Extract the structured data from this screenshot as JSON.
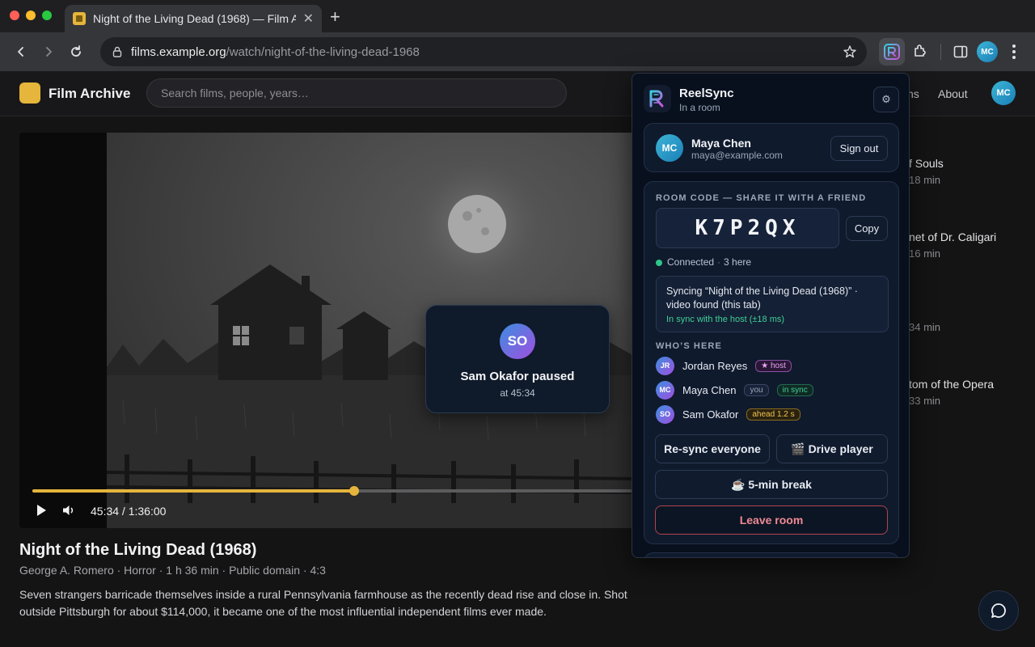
{
  "browser": {
    "tab_title": "Night of the Living Dead (1968) — Film A…",
    "url_host": "films.example.org",
    "url_path": "/watch/night-of-the-living-dead-1968",
    "profile_initials": "MC"
  },
  "site": {
    "logo_text": "Film Archive",
    "search_placeholder": "Search films, people, years…",
    "nav": [
      "ns",
      "About"
    ],
    "avatar_initials": "MC"
  },
  "player": {
    "time_current": "45:34",
    "time_total": "1:36:00",
    "progress_fraction": 0.535,
    "toast": {
      "initials": "SO",
      "title": "Sam Okafor paused",
      "subtitle": "at 45:34"
    }
  },
  "film": {
    "title": "Night of the Living Dead (1968)",
    "meta": "George A. Romero · Horror · 1 h 36 min · Public domain · 4:3",
    "description": "Seven strangers barricade themselves inside a rural Pennsylvania farmhouse as the recently dead rise and close in. Shot outside Pittsburgh for about $114,000, it became one of the most influential independent films ever made."
  },
  "sidebar_list": [
    {
      "title": "f Souls",
      "sub": "18 min"
    },
    {
      "title": "net of Dr. Caligari",
      "sub": "16 min"
    },
    {
      "title": "",
      "sub": "34 min"
    },
    {
      "title": "tom of the Opera",
      "sub": "33 min"
    }
  ],
  "extension": {
    "name": "ReelSync",
    "status": "In a room",
    "gear_icon": "⚙",
    "user": {
      "initials": "MC",
      "name": "Maya Chen",
      "email": "maya@example.com",
      "sign_out": "Sign out"
    },
    "room_label": "ROOM CODE — SHARE IT WITH A FRIEND",
    "room_code": "K7P2QX",
    "copy_label": "Copy",
    "connection": "Connected",
    "count": "3 here",
    "sync_line": "Syncing “Night of the Living Dead (1968)” · video found (this tab)",
    "sync_ok": "In sync with the host (±18 ms)",
    "members_label": "WHO’S HERE",
    "members": [
      {
        "initials": "JR",
        "name": "Jordan Reyes",
        "badges": [
          "★ host"
        ]
      },
      {
        "initials": "MC",
        "name": "Maya Chen",
        "badges": [
          "you",
          "in sync"
        ]
      },
      {
        "initials": "SO",
        "name": "Sam Okafor",
        "badges": [
          "ahead 1.2 s"
        ]
      }
    ],
    "resync_label": "Re-sync everyone",
    "drive_label": "🎬 Drive player",
    "break_label": "☕ 5-min break",
    "leave_label": "Leave room"
  },
  "colors": {
    "accent": "#e5b53c",
    "popup_bg": "#08101d",
    "success": "#3fcf98",
    "danger": "#f08a94"
  }
}
